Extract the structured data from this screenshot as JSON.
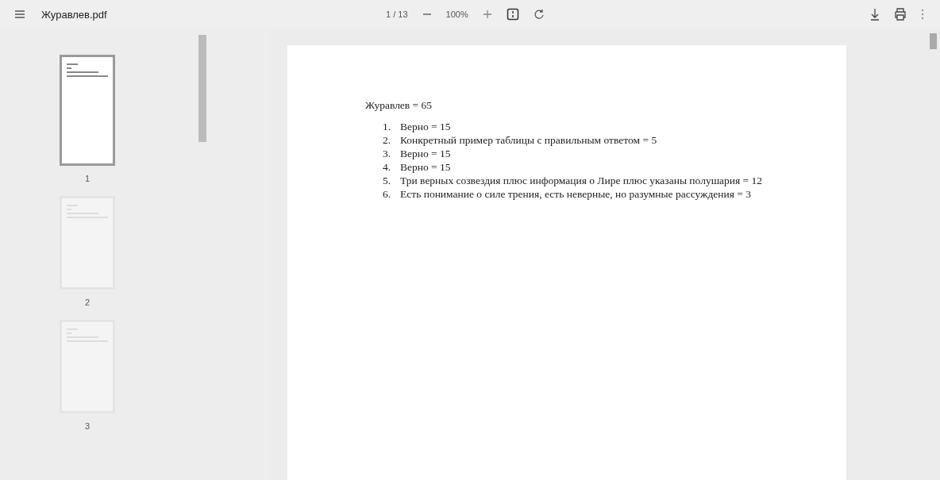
{
  "toolbar": {
    "title": "Журавлев.pdf",
    "page_indicator": "1 / 13",
    "zoom": "100%"
  },
  "thumbnails": [
    {
      "label": "1",
      "selected": true
    },
    {
      "label": "2",
      "selected": false
    },
    {
      "label": "3",
      "selected": false
    }
  ],
  "document": {
    "heading": "Журавлев = 65",
    "items": [
      {
        "number": "1.",
        "text": "Верно = 15"
      },
      {
        "number": "2.",
        "text": "Конкретный пример таблицы с правильным ответом = 5"
      },
      {
        "number": "3.",
        "text": "Верно = 15"
      },
      {
        "number": "4.",
        "text": "Верно = 15"
      },
      {
        "number": "5.",
        "text": "Три верных созвездия плюс информация о Лире плюс указаны полушария = 12"
      },
      {
        "number": "6.",
        "text": "Есть понимание о силе трения, есть неверные, но разумные рассуждения = 3"
      }
    ]
  }
}
